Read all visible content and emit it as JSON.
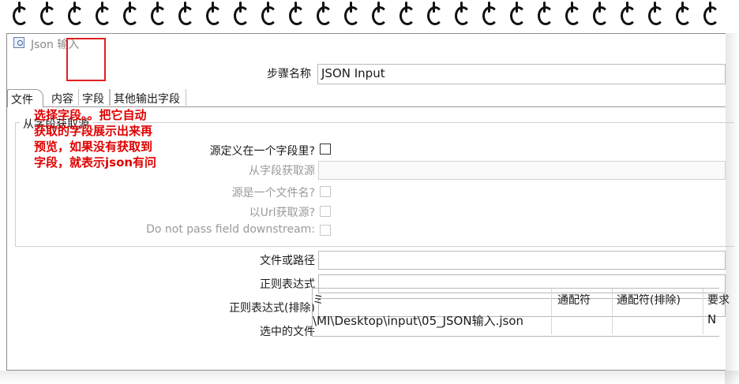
{
  "window": {
    "title": "Json 输入"
  },
  "step_name": {
    "label": "步骤名称",
    "value": "JSON Input"
  },
  "tabs": [
    {
      "label": "文件"
    },
    {
      "label": "内容"
    },
    {
      "label": "字段"
    },
    {
      "label": "其他输出字段"
    }
  ],
  "source_group": {
    "title": "从字段获取源",
    "fields": [
      {
        "label": "源定义在一个字段里?",
        "type": "checkbox",
        "checked": false,
        "enabled": true
      },
      {
        "label": "从字段获取源",
        "type": "select",
        "value": "",
        "enabled": false
      },
      {
        "label": "源是一个文件名?",
        "type": "checkbox",
        "checked": false,
        "enabled": false
      },
      {
        "label": "以Url获取源?",
        "type": "checkbox",
        "checked": false,
        "enabled": false
      },
      {
        "label": "Do not pass field downstream:",
        "type": "checkbox",
        "checked": false,
        "enabled": false
      }
    ]
  },
  "annotation": {
    "text": "选择字段。。把它自动\n获取的字段展示出来再\n预览，如果没有获取到\n字段，就表示json有问"
  },
  "file_fields": [
    {
      "label": "文件或路径",
      "value": ""
    },
    {
      "label": "正则表达式",
      "value": ""
    },
    {
      "label": "正则表达式(排除)",
      "value": ""
    }
  ],
  "selected_files": {
    "label": "选中的文件",
    "columns": [
      "ミ",
      "通配符",
      "通配符(排除)",
      "要求"
    ],
    "rows": [
      [
        "\\MI\\Desktop\\input\\05_JSON输入.json",
        "",
        "",
        "N"
      ]
    ]
  },
  "colors": {
    "annotation": "#e00000",
    "highlight_box": "#e02020"
  }
}
